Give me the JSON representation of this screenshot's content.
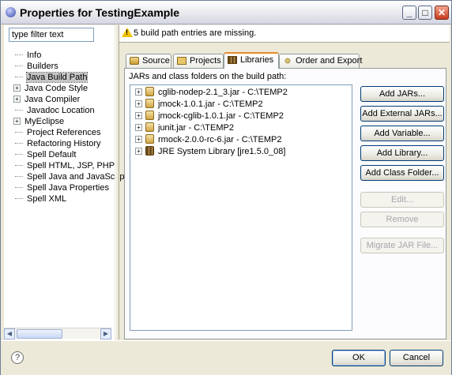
{
  "window": {
    "title": "Properties for TestingExample"
  },
  "filter": {
    "value": "type filter text"
  },
  "tree": [
    {
      "label": "Info",
      "expandable": false
    },
    {
      "label": "Builders",
      "expandable": false
    },
    {
      "label": "Java Build Path",
      "expandable": false,
      "selected": true
    },
    {
      "label": "Java Code Style",
      "expandable": true
    },
    {
      "label": "Java Compiler",
      "expandable": true
    },
    {
      "label": "Javadoc Location",
      "expandable": false
    },
    {
      "label": "MyEclipse",
      "expandable": true
    },
    {
      "label": "Project References",
      "expandable": false
    },
    {
      "label": "Refactoring History",
      "expandable": false
    },
    {
      "label": "Spell Default",
      "expandable": false
    },
    {
      "label": "Spell HTML, JSP, PHP",
      "expandable": false
    },
    {
      "label": "Spell Java and JavaScrip",
      "expandable": false
    },
    {
      "label": "Spell Java Properties",
      "expandable": false
    },
    {
      "label": "Spell XML",
      "expandable": false
    }
  ],
  "message": {
    "text": "5 build path entries are missing."
  },
  "tabs": [
    {
      "label": "Source",
      "icon": "source-folder-icon"
    },
    {
      "label": "Projects",
      "icon": "project-folder-icon"
    },
    {
      "label": "Libraries",
      "icon": "library-icon",
      "active": true
    },
    {
      "label": "Order and Export",
      "icon": "order-export-icon"
    }
  ],
  "panel": {
    "label": "JARs and class folders on the build path:"
  },
  "jars": [
    {
      "label": "cglib-nodep-2.1_3.jar - C:\\TEMP2",
      "icon": "jar-icon"
    },
    {
      "label": "jmock-1.0.1.jar - C:\\TEMP2",
      "icon": "jar-icon"
    },
    {
      "label": "jmock-cglib-1.0.1.jar - C:\\TEMP2",
      "icon": "jar-icon"
    },
    {
      "label": "junit.jar - C:\\TEMP2",
      "icon": "jar-icon"
    },
    {
      "label": "rmock-2.0.0-rc-6.jar - C:\\TEMP2",
      "icon": "jar-icon"
    },
    {
      "label": "JRE System Library [jre1.5.0_08]",
      "icon": "library-icon"
    }
  ],
  "buttons": {
    "add_jars": "Add JARs...",
    "add_external_jars": "Add External JARs...",
    "add_variable": "Add Variable...",
    "add_library": "Add Library...",
    "add_class_folder": "Add Class Folder...",
    "edit": "Edit...",
    "remove": "Remove",
    "migrate": "Migrate JAR File..."
  },
  "dialog": {
    "ok": "OK",
    "cancel": "Cancel",
    "help": "?"
  },
  "controls": {
    "minimize": "_",
    "maximize": "□",
    "close": "✕"
  }
}
